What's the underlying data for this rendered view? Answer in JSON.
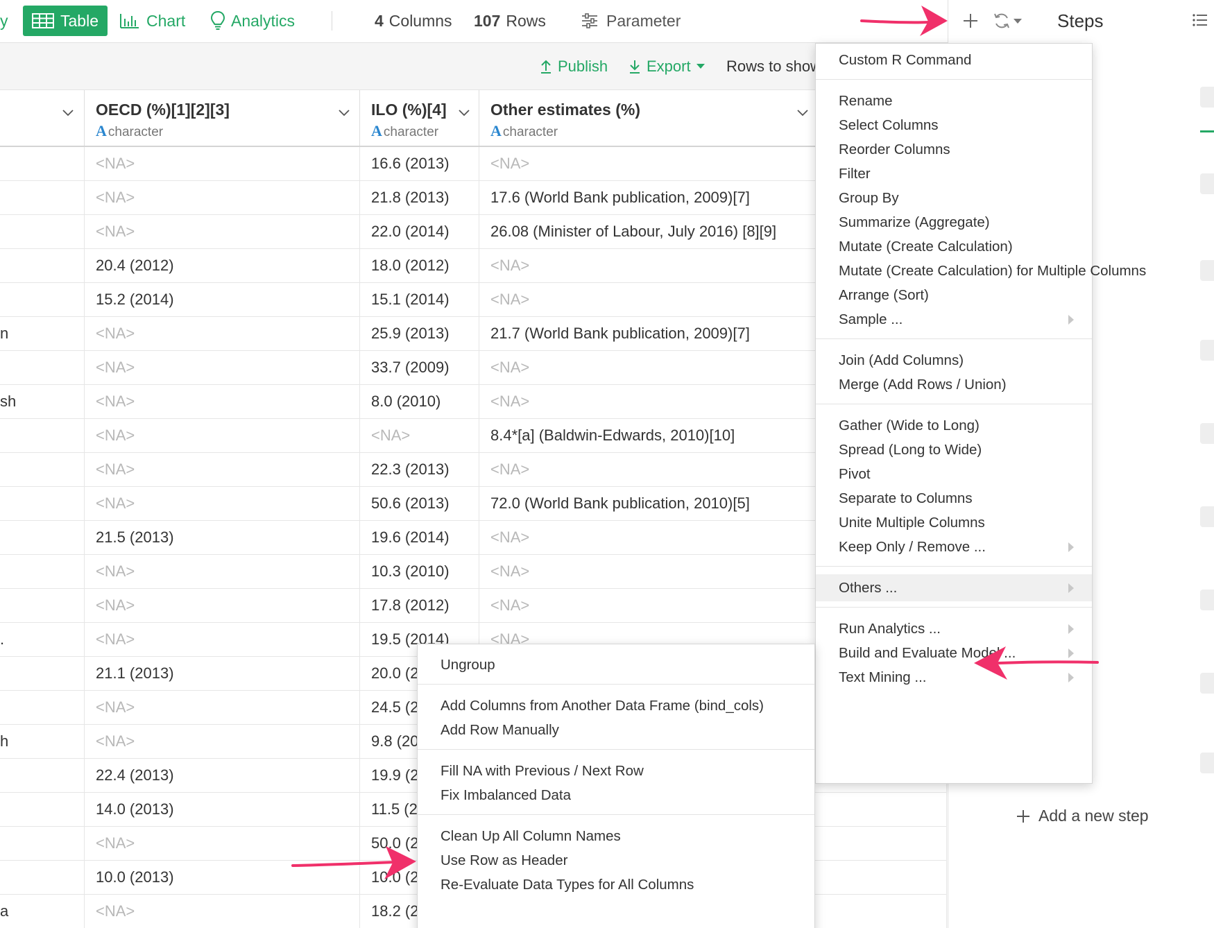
{
  "toolbar": {
    "cut_label": "y",
    "table_tab": "Table",
    "chart_tab": "Chart",
    "analytics_tab": "Analytics",
    "columns_count": "4",
    "columns_label": "Columns",
    "rows_count": "107",
    "rows_label": "Rows",
    "parameter": "Parameter",
    "accent_color": "#24a865"
  },
  "subbar": {
    "publish": "Publish",
    "export": "Export",
    "rows_to_show": "Rows to show"
  },
  "table": {
    "columns": [
      {
        "name": "",
        "type": ""
      },
      {
        "name": "OECD (%)[1][2][3]",
        "type": "character"
      },
      {
        "name": "ILO (%)[4]",
        "type": "character"
      },
      {
        "name": "Other estimates (%)",
        "type": "character"
      }
    ],
    "rows": [
      [
        "",
        "<NA>",
        "16.6 (2013)",
        "<NA>"
      ],
      [
        "",
        "<NA>",
        "21.8 (2013)",
        "17.6 (World Bank publication, 2009)[7]"
      ],
      [
        "",
        "<NA>",
        "22.0 (2014)",
        "26.08 (Minister of Labour, July 2016) [8][9]"
      ],
      [
        "",
        "20.4 (2012)",
        "18.0 (2012)",
        "<NA>"
      ],
      [
        "",
        "15.2 (2014)",
        "15.1 (2014)",
        "<NA>"
      ],
      [
        "n",
        "<NA>",
        "25.9 (2013)",
        "21.7 (World Bank publication, 2009)[7]"
      ],
      [
        "",
        "<NA>",
        "33.7 (2009)",
        "<NA>"
      ],
      [
        "sh",
        "<NA>",
        "8.0 (2010)",
        "<NA>"
      ],
      [
        "",
        "<NA>",
        "<NA>",
        "8.4*[a] (Baldwin-Edwards, 2010)[10]"
      ],
      [
        "",
        "<NA>",
        "22.3 (2013)",
        "<NA>"
      ],
      [
        "",
        "<NA>",
        "50.6 (2013)",
        "72.0 (World Bank publication, 2010)[5]"
      ],
      [
        "",
        "21.5 (2013)",
        "19.6 (2014)",
        "<NA>"
      ],
      [
        "",
        "<NA>",
        "10.3 (2010)",
        "<NA>"
      ],
      [
        "",
        "<NA>",
        "17.8 (2012)",
        "<NA>"
      ],
      [
        ".",
        "<NA>",
        "19.5 (2014)",
        "<NA>"
      ],
      [
        "",
        "21.1 (2013)",
        "20.0 (2",
        ""
      ],
      [
        "",
        "<NA>",
        "24.5 (2",
        ""
      ],
      [
        "h",
        "<NA>",
        "9.8 (20",
        ""
      ],
      [
        "",
        "22.4 (2013)",
        "19.9 (2",
        ""
      ],
      [
        "",
        "14.0 (2013)",
        "11.5 (2",
        ""
      ],
      [
        "",
        "<NA>",
        "50.0 (2",
        ""
      ],
      [
        "",
        "10.0 (2013)",
        "10.0 (2",
        ""
      ],
      [
        "a",
        "<NA>",
        "18.2 (2",
        ""
      ]
    ]
  },
  "steps": {
    "title": "Steps",
    "add_step": "Add a new step"
  },
  "main_menu": {
    "groups": [
      [
        {
          "label": "Custom R Command"
        }
      ],
      [
        {
          "label": "Rename"
        },
        {
          "label": "Select Columns"
        },
        {
          "label": "Reorder Columns"
        },
        {
          "label": "Filter"
        },
        {
          "label": "Group By"
        },
        {
          "label": "Summarize (Aggregate)"
        },
        {
          "label": "Mutate (Create Calculation)"
        },
        {
          "label": "Mutate (Create Calculation) for Multiple Columns"
        },
        {
          "label": "Arrange (Sort)"
        },
        {
          "label": "Sample ...",
          "submenu": true
        }
      ],
      [
        {
          "label": "Join (Add Columns)"
        },
        {
          "label": "Merge (Add Rows / Union)"
        }
      ],
      [
        {
          "label": "Gather (Wide to Long)"
        },
        {
          "label": "Spread (Long to Wide)"
        },
        {
          "label": "Pivot"
        },
        {
          "label": "Separate to Columns"
        },
        {
          "label": "Unite Multiple Columns"
        },
        {
          "label": "Keep Only / Remove ...",
          "submenu": true
        }
      ],
      [
        {
          "label": "Others ...",
          "submenu": true,
          "highlighted": true
        }
      ],
      [
        {
          "label": "Run Analytics ...",
          "submenu": true
        },
        {
          "label": "Build and Evaluate Model ...",
          "submenu": true
        },
        {
          "label": "Text Mining ...",
          "submenu": true
        }
      ]
    ]
  },
  "sub_menu": {
    "groups": [
      [
        {
          "label": "Ungroup"
        }
      ],
      [
        {
          "label": "Add Columns from Another Data Frame (bind_cols)"
        },
        {
          "label": "Add Row Manually"
        }
      ],
      [
        {
          "label": "Fill NA with Previous / Next Row"
        },
        {
          "label": "Fix Imbalanced Data"
        }
      ],
      [
        {
          "label": "Clean Up All Column Names"
        },
        {
          "label": "Use Row as Header"
        },
        {
          "label": "Re-Evaluate Data Types for All Columns"
        }
      ]
    ]
  },
  "annotation_color": "#f0306a"
}
